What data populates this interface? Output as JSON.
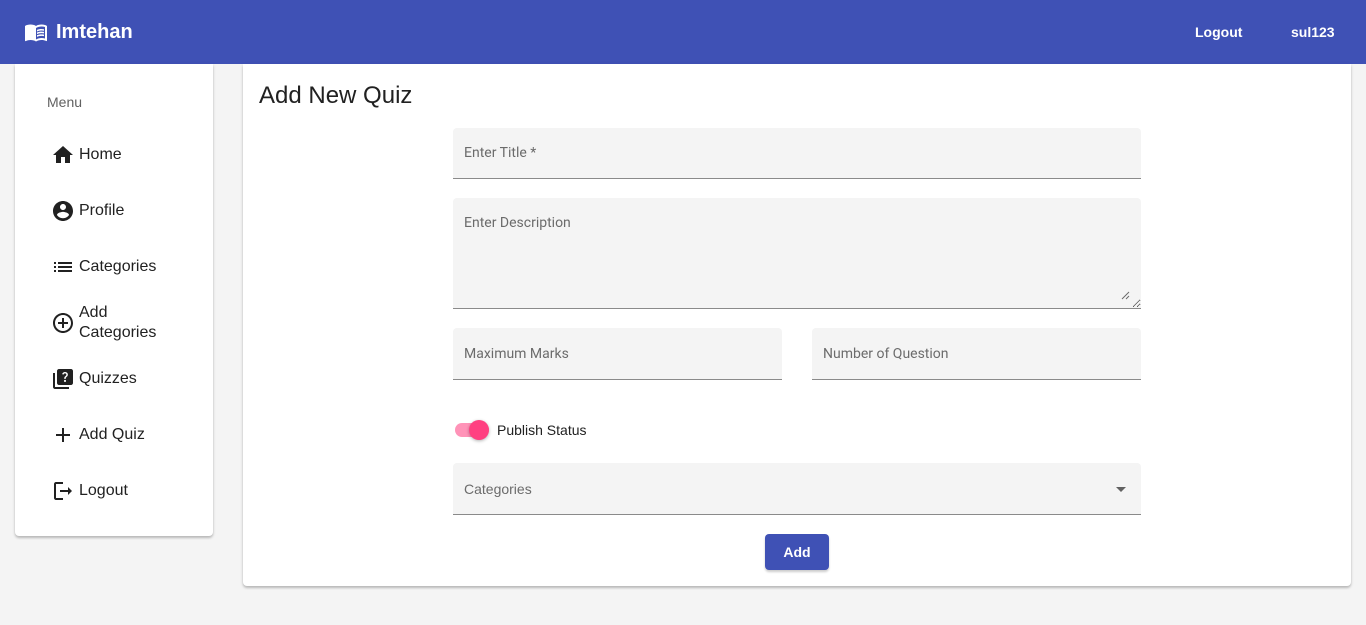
{
  "header": {
    "brand_icon": "book-open-icon",
    "brand_name": "Imtehan",
    "logout_label": "Logout",
    "username": "sul123",
    "background_color": "#3f51b5"
  },
  "sidebar": {
    "menu_title": "Menu",
    "items": [
      {
        "label": "Home",
        "icon": "home-icon"
      },
      {
        "label": "Profile",
        "icon": "account-circle-icon"
      },
      {
        "label": "Categories",
        "icon": "list-icon"
      },
      {
        "label": "Add Categories",
        "icon": "add-circle-outline-icon"
      },
      {
        "label": "Quizzes",
        "icon": "quiz-icon"
      },
      {
        "label": "Add Quiz",
        "icon": "add-icon"
      },
      {
        "label": "Logout",
        "icon": "logout-icon"
      }
    ]
  },
  "form": {
    "title": "Add New Quiz",
    "title_placeholder": "Enter Title *",
    "description_placeholder": "Enter Description",
    "max_marks_placeholder": "Maximum Marks",
    "num_questions_placeholder": "Number of Question",
    "publish_label": "Publish Status",
    "publish_on": true,
    "categories_placeholder": "Categories",
    "submit_label": "Add",
    "accent_color": "#ff4081"
  }
}
